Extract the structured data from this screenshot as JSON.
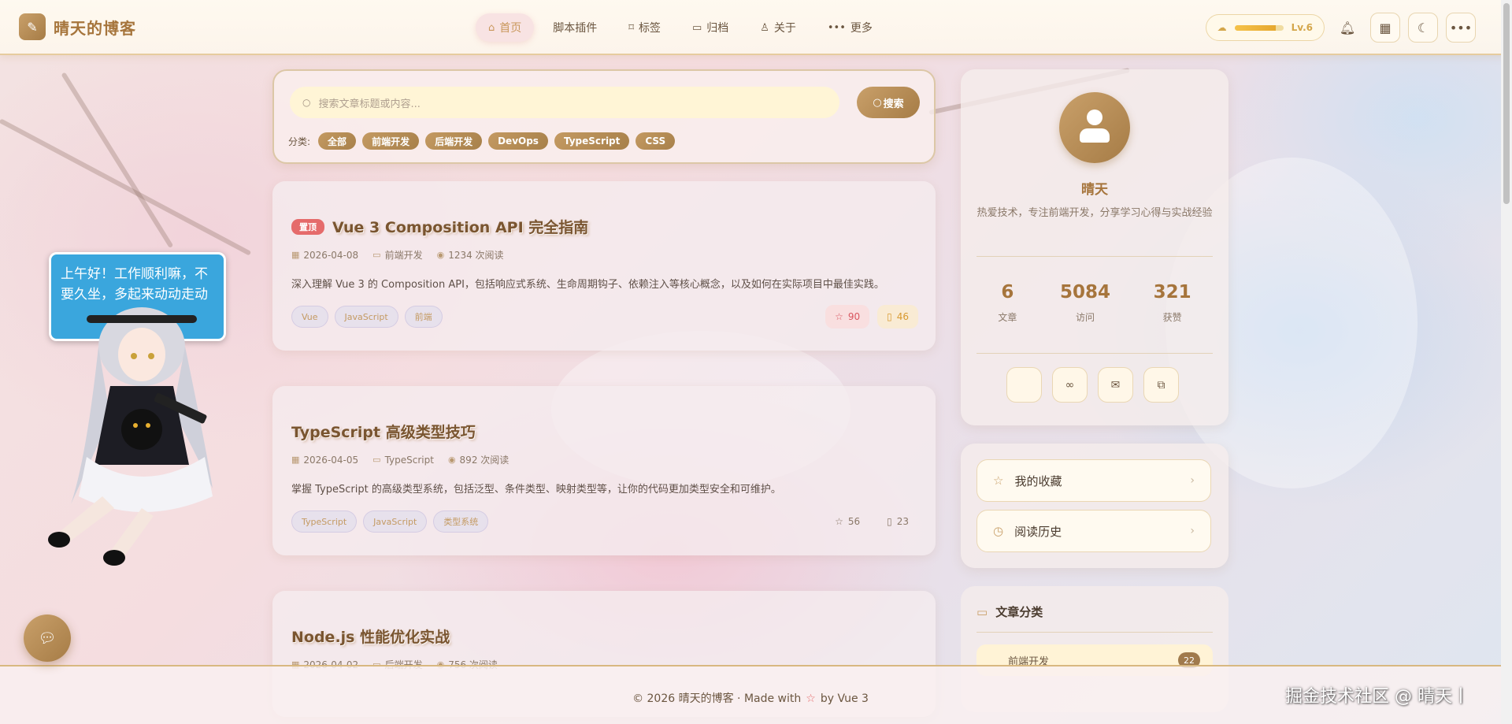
{
  "header": {
    "logo_icon": "edit-icon",
    "site_title": "晴天的博客",
    "nav": [
      {
        "label": "首页",
        "icon": "home-icon",
        "active": true
      },
      {
        "label": "脚本插件",
        "icon": "",
        "active": false
      },
      {
        "label": "标签",
        "icon": "tag-icon",
        "active": false
      },
      {
        "label": "归档",
        "icon": "folder-icon",
        "active": false
      },
      {
        "label": "关于",
        "icon": "user-icon",
        "active": false
      },
      {
        "label": "更多",
        "icon": "more-icon",
        "active": false
      }
    ],
    "level": {
      "label": "Lv.6",
      "progress": 0.85
    }
  },
  "search": {
    "placeholder": "搜索文章标题或内容...",
    "button_label": "搜索",
    "category_label": "分类:",
    "categories": [
      "全部",
      "前端开发",
      "后端开发",
      "DevOps",
      "TypeScript",
      "CSS"
    ]
  },
  "posts": [
    {
      "pinned": true,
      "pin_label": "置顶",
      "title": "Vue 3 Composition API 完全指南",
      "date": "2026-04-08",
      "category": "前端开发",
      "views": "1234 次阅读",
      "excerpt": "深入理解 Vue 3 的 Composition API，包括响应式系统、生命周期钩子、依赖注入等核心概念，以及如何在实际项目中最佳实践。",
      "tags": [
        "Vue",
        "JavaScript",
        "前端"
      ],
      "likes": "90",
      "bookmarks": "46"
    },
    {
      "pinned": false,
      "title": "TypeScript 高级类型技巧",
      "date": "2026-04-05",
      "category": "TypeScript",
      "views": "892 次阅读",
      "excerpt": "掌握 TypeScript 的高级类型系统，包括泛型、条件类型、映射类型等，让你的代码更加类型安全和可维护。",
      "tags": [
        "TypeScript",
        "JavaScript",
        "类型系统"
      ],
      "likes": "56",
      "bookmarks": "23"
    },
    {
      "pinned": false,
      "title": "Node.js 性能优化实战",
      "date": "2026-04-02",
      "category": "后端开发",
      "views": "756 次阅读"
    }
  ],
  "profile": {
    "name": "晴天",
    "bio": "热爱技术，专注前端开发，分享学习心得与实战经验",
    "stats": [
      {
        "value": "6",
        "label": "文章"
      },
      {
        "value": "5084",
        "label": "访问"
      },
      {
        "value": "321",
        "label": "获赞"
      }
    ]
  },
  "quick_links": [
    {
      "label": "我的收藏",
      "icon": "star-icon"
    },
    {
      "label": "阅读历史",
      "icon": "clock-icon"
    }
  ],
  "categories_widget": {
    "title": "文章分类",
    "items": [
      {
        "label": "前端开发",
        "count": "22"
      }
    ]
  },
  "mascot": {
    "greeting": "上午好！工作顺利嘛，不要久坐，多起来动动走动"
  },
  "footer": {
    "prefix": "© 2026 晴天的博客 · Made with",
    "suffix": "by Vue 3"
  },
  "watermark": "掘金技术社区 @ 晴天丨",
  "colors": {
    "accent": "#a6753c",
    "accent_light": "#c9a06a",
    "pin": "#e56b6b",
    "bubble": "#3aa6dd"
  }
}
